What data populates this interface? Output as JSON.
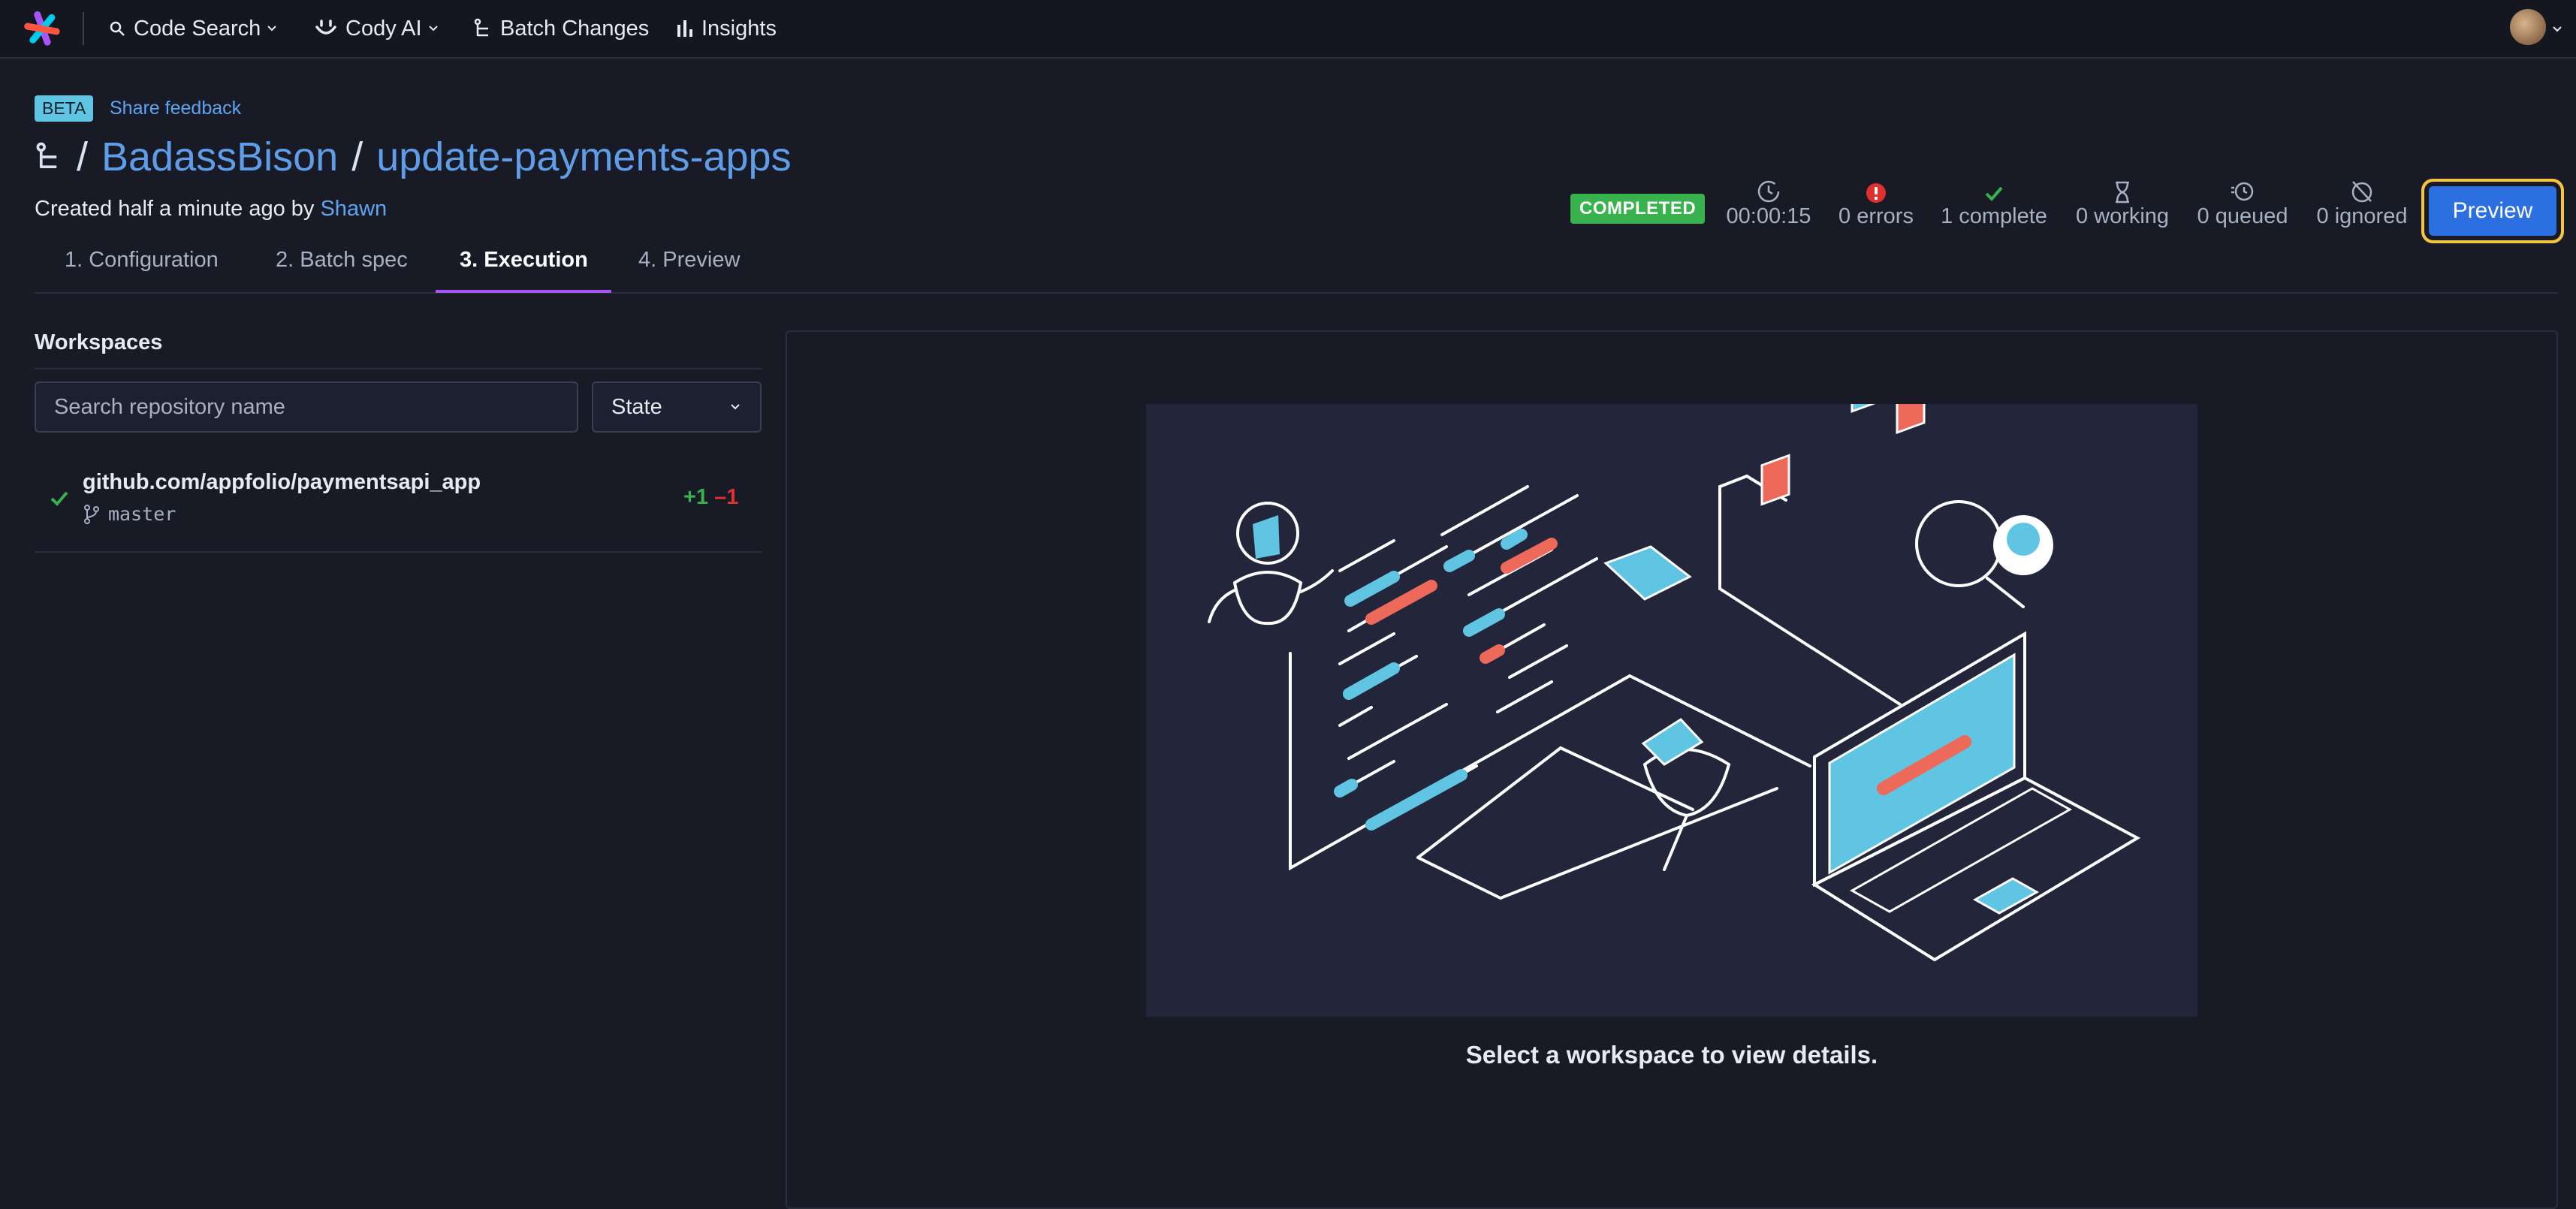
{
  "nav": {
    "code_search": "Code Search",
    "cody": "Cody AI",
    "batch_changes": "Batch Changes",
    "insights": "Insights"
  },
  "header": {
    "beta": "BETA",
    "share_feedback": "Share feedback",
    "namespace": "BadassBison",
    "name": "update-payments-apps",
    "created_prefix": "Created half a minute ago by",
    "author": "Shawn"
  },
  "tabs": [
    "1. Configuration",
    "2. Batch spec",
    "3. Execution",
    "4. Preview"
  ],
  "status": {
    "state": "COMPLETED",
    "duration": "00:00:15",
    "errors": "0 errors",
    "complete": "1 complete",
    "working": "0 working",
    "queued": "0 queued",
    "ignored": "0 ignored",
    "preview_button": "Preview"
  },
  "workspaces": {
    "heading": "Workspaces",
    "search_placeholder": "Search repository name",
    "state_filter": "State",
    "items": [
      {
        "repo": "github.com/appfolio/paymentsapi_app",
        "branch": "master",
        "added": "+1",
        "removed": "–1"
      }
    ]
  },
  "detail": {
    "empty_message": "Select a workspace to view details."
  },
  "colors": {
    "accent": "#5f9de9",
    "success": "#37b24d",
    "error": "#e03131",
    "highlight": "#f5c542"
  }
}
